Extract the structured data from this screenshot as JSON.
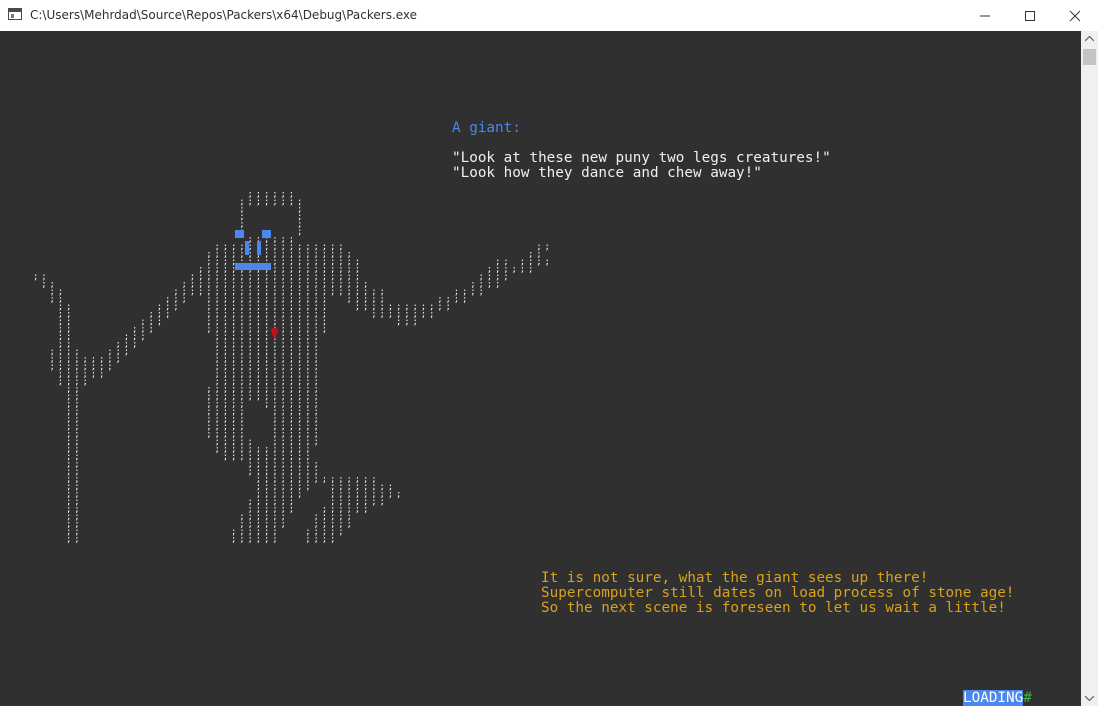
{
  "window": {
    "title": "C:\\Users\\Mehrdad\\Source\\Repos\\Packers\\x64\\Debug\\Packers.exe",
    "controls": [
      "minimize-icon",
      "maximize-icon",
      "close-icon"
    ]
  },
  "console": {
    "speaker": "A giant:",
    "quote_lines": [
      "\"Look at these new puny two legs creatures!\"",
      "\"Look how they dance and chew away!\""
    ],
    "notes": [
      "It is not sure, what the giant sees up there!",
      "Supercomputer still dates on load process of stone age!",
      "So the next scene is foreseen to let us wait a little!"
    ],
    "loading": {
      "label": "LOADING",
      "progress_glyph": "#"
    },
    "art": {
      "dot_glyph": ";",
      "colors": {
        "background": "#303030",
        "dots": "#f0f0f0",
        "face": "#4a88ee",
        "heart": "#c0101a",
        "speaker": "#4a88ee",
        "notes": "#d9a21b",
        "loading_bg": "#4a88ee",
        "progress": "#3cb83c"
      }
    }
  }
}
